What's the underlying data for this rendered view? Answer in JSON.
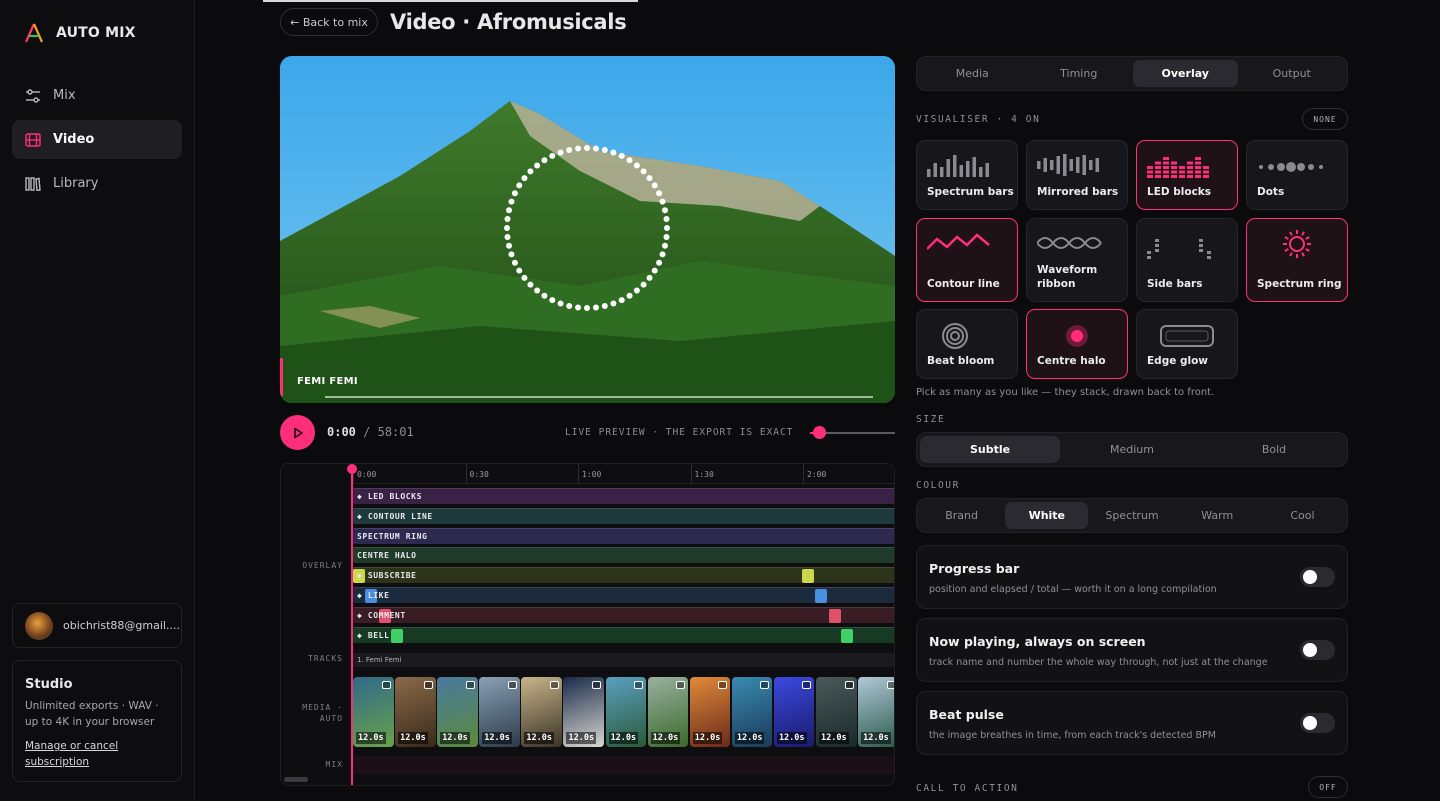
{
  "app": {
    "name": "AUTO MIX"
  },
  "nav": [
    {
      "label": "Mix",
      "icon": "sliders-icon"
    },
    {
      "label": "Video",
      "icon": "film-icon"
    },
    {
      "label": "Library",
      "icon": "library-icon"
    }
  ],
  "account": {
    "email": "obichrist88@gmail...."
  },
  "studio": {
    "title": "Studio",
    "desc": "Unlimited exports · WAV · up to 4K in your browser",
    "link": "Manage or cancel subscription"
  },
  "header": {
    "back": "← Back to mix",
    "title": "Video · Afromusicals"
  },
  "preview": {
    "track_label": "FEMI FEMI"
  },
  "transport": {
    "current": "0:00",
    "total": "/ 58:01",
    "note": "LIVE PREVIEW · THE EXPORT IS EXACT",
    "volume_pct": 3
  },
  "timeline": {
    "ticks": [
      "0:00",
      "0:30",
      "1:00",
      "1:30",
      "2:00"
    ],
    "section_labels": {
      "overlay": "OVERLAY",
      "tracks": "TRACKS",
      "media": "MEDIA · AUTO",
      "mix": "MIX"
    },
    "overlay_lanes": [
      {
        "label": "◆ LED BLOCKS",
        "color": "#3a2146"
      },
      {
        "label": "◆ CONTOUR LINE",
        "color": "#1f3a3c"
      },
      {
        "label": "SPECTRUM RING",
        "color": "#2d2a52"
      },
      {
        "label": "CENTRE HALO",
        "color": "#1f3b2a"
      },
      {
        "label": "◆ SUBSCRIBE",
        "color": "#2e3419",
        "mark": "#c9d94a"
      },
      {
        "label": "◆ LIKE",
        "color": "#1c2a3e",
        "mark": "#4a90e2"
      },
      {
        "label": "◆ COMMENT",
        "color": "#3a1c24",
        "mark": "#e0516b"
      },
      {
        "label": "◆ BELL",
        "color": "#163b22",
        "mark": "#3fd067"
      }
    ],
    "track_name": "1. Femi Femi",
    "thumb_duration": "12.0s",
    "thumb_count": 13
  },
  "panel": {
    "tabs": [
      "Media",
      "Timing",
      "Overlay",
      "Output"
    ],
    "active_tab": "Overlay",
    "visualiser": {
      "heading": "VISUALISER · 4 ON",
      "none_btn": "NONE",
      "hint": "Pick as many as you like — they stack, drawn back to front.",
      "items": [
        {
          "label": "Spectrum bars",
          "on": false
        },
        {
          "label": "Mirrored bars",
          "on": false
        },
        {
          "label": "LED blocks",
          "on": true
        },
        {
          "label": "Dots",
          "on": false
        },
        {
          "label": "Contour line",
          "on": true
        },
        {
          "label": "Waveform ribbon",
          "on": false
        },
        {
          "label": "Side bars",
          "on": false
        },
        {
          "label": "Spectrum ring",
          "on": true
        },
        {
          "label": "Beat bloom",
          "on": false
        },
        {
          "label": "Centre halo",
          "on": true
        },
        {
          "label": "Edge glow",
          "on": false
        }
      ]
    },
    "size": {
      "heading": "SIZE",
      "options": [
        "Subtle",
        "Medium",
        "Bold"
      ],
      "active": "Subtle"
    },
    "colour": {
      "heading": "COLOUR",
      "options": [
        "Brand",
        "White",
        "Spectrum",
        "Warm",
        "Cool"
      ],
      "active": "White"
    },
    "toggles": [
      {
        "title": "Progress bar",
        "desc": "position and elapsed / total — worth it on a long compilation",
        "on": false
      },
      {
        "title": "Now playing, always on screen",
        "desc": "track name and number the whole way through, not just at the change",
        "on": false
      },
      {
        "title": "Beat pulse",
        "desc": "the image breathes in time, from each track's detected BPM",
        "on": false
      }
    ],
    "cta": {
      "heading": "CALL TO ACTION",
      "state": "OFF"
    }
  },
  "colors": {
    "accent": "#ff2e7a",
    "bg": "#0b0b0d"
  }
}
